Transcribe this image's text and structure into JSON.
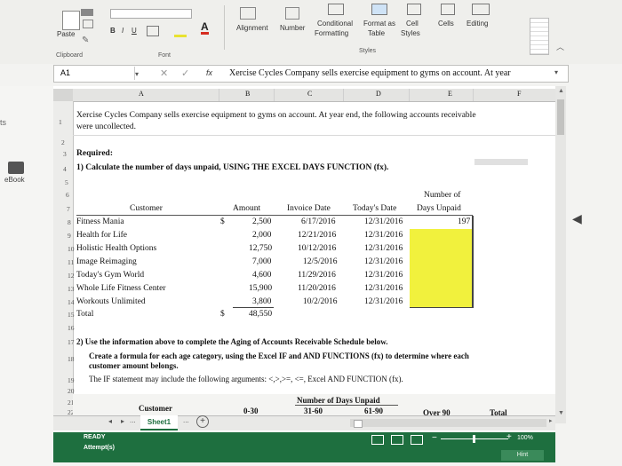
{
  "ribbon": {
    "paste": "Paste",
    "font_buttons": [
      "B",
      "I",
      "U"
    ],
    "alignment": "Alignment",
    "number": "Number",
    "conditional_formatting_1": "Conditional",
    "conditional_formatting_2": "Formatting",
    "format_as_table_1": "Format as",
    "format_as_table_2": "Table",
    "cell_styles_1": "Cell",
    "cell_styles_2": "Styles",
    "cells": "Cells",
    "editing": "Editing",
    "groups": {
      "clipboard": "Clipboard",
      "font": "Font",
      "styles": "Styles"
    }
  },
  "left_panel": {
    "item1": "ts",
    "ebook": "eBook"
  },
  "formula_bar": {
    "name_box": "A1",
    "fx": "fx",
    "content": "Xercise Cycles Company sells exercise equipment to gyms on account. At year"
  },
  "columns": [
    "A",
    "B",
    "C",
    "D",
    "E",
    "F"
  ],
  "sheet": {
    "row1_line1": "Xercise Cycles Company sells exercise equipment to gyms on account. At year end, the following accounts receivable",
    "row1_line2": "were uncollected.",
    "required": "Required:",
    "q1": "1) Calculate the number of days unpaid, USING THE EXCEL DAYS FUNCTION (fx).",
    "hdr_customer": "Customer",
    "hdr_amount": "Amount",
    "hdr_invoice": "Invoice Date",
    "hdr_today": "Today's Date",
    "hdr_days_1": "Number of",
    "hdr_days_2": "Days Unpaid",
    "dollar": "$",
    "rows": [
      {
        "customer": "Fitness Mania",
        "amount": "2,500",
        "invoice": "6/17/2016",
        "today": "12/31/2016",
        "days": "197"
      },
      {
        "customer": "Health for Life",
        "amount": "2,000",
        "invoice": "12/21/2016",
        "today": "12/31/2016",
        "days": ""
      },
      {
        "customer": "Holistic Health Options",
        "amount": "12,750",
        "invoice": "10/12/2016",
        "today": "12/31/2016",
        "days": ""
      },
      {
        "customer": "Image Reimaging",
        "amount": "7,000",
        "invoice": "12/5/2016",
        "today": "12/31/2016",
        "days": ""
      },
      {
        "customer": "Today's Gym World",
        "amount": "4,600",
        "invoice": "11/29/2016",
        "today": "12/31/2016",
        "days": ""
      },
      {
        "customer": "Whole Life Fitness Center",
        "amount": "15,900",
        "invoice": "11/20/2016",
        "today": "12/31/2016",
        "days": ""
      },
      {
        "customer": "Workouts Unlimited",
        "amount": "3,800",
        "invoice": "10/2/2016",
        "today": "12/31/2016",
        "days": ""
      }
    ],
    "total_label": "Total",
    "total_amount": "48,550",
    "q2": "2) Use the information above to complete the Aging of Accounts Receivable Schedule below.",
    "q18_line1": "Create a formula for each age category, using the Excel IF and AND FUNCTIONS (fx) to determine where each",
    "q18_line2": "customer amount belongs.",
    "q19": "The IF statement may include the following arguments: <,>,>=, <=, Excel AND FUNCTION (fx).",
    "aging_title": "Number of Days Unpaid",
    "aging_customer": "Customer",
    "aging_cols": [
      "0-30",
      "31-60",
      "61-90",
      "Over 90",
      "Total"
    ]
  },
  "row_numbers": [
    "1",
    "2",
    "3",
    "4",
    "5",
    "6",
    "7",
    "8",
    "9",
    "10",
    "11",
    "12",
    "13",
    "14",
    "15",
    "16",
    "17",
    "18",
    "19",
    "20",
    "21",
    "22"
  ],
  "tabs": {
    "sheet1": "Sheet1",
    "ellipsis": "..."
  },
  "status": {
    "ready": "READY",
    "attempts": "Attempt(s)",
    "zoom": "100%",
    "hint": "Hint"
  }
}
